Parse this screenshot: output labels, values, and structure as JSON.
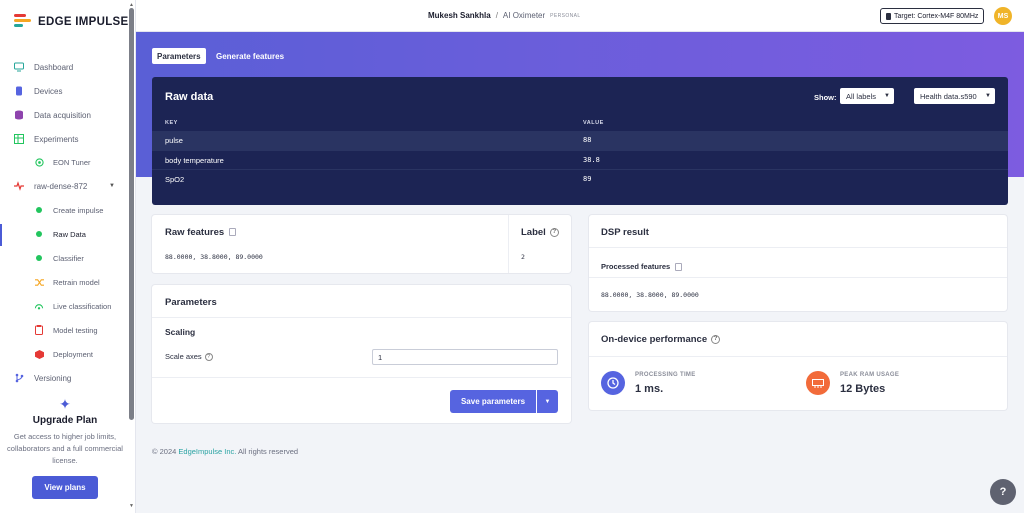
{
  "app": {
    "brand": "EDGE IMPULSE",
    "brand_colors": [
      "#e53935",
      "#f5a623",
      "#26a69a"
    ]
  },
  "sidebar": {
    "items": [
      {
        "label": "Dashboard",
        "icon": "monitor-icon"
      },
      {
        "label": "Devices",
        "icon": "devices-icon"
      },
      {
        "label": "Data acquisition",
        "icon": "database-icon"
      },
      {
        "label": "Experiments",
        "icon": "table-icon"
      },
      {
        "label": "EON Tuner",
        "icon": "tuner-icon"
      },
      {
        "label": "raw-dense-872",
        "icon": "pulse-icon"
      },
      {
        "label": "Create impulse",
        "icon": "dot-icon"
      },
      {
        "label": "Raw Data",
        "icon": "dot-icon"
      },
      {
        "label": "Classifier",
        "icon": "dot-icon"
      },
      {
        "label": "Retrain model",
        "icon": "shuffle-icon"
      },
      {
        "label": "Live classification",
        "icon": "live-icon"
      },
      {
        "label": "Model testing",
        "icon": "clipboard-icon"
      },
      {
        "label": "Deployment",
        "icon": "package-icon"
      },
      {
        "label": "Versioning",
        "icon": "branch-icon"
      }
    ],
    "upgrade": {
      "title": "Upgrade Plan",
      "text": "Get access to higher job limits, collaborators and a full commercial license.",
      "button": "View plans"
    }
  },
  "header": {
    "user": "Mukesh Sankhla",
    "separator": "/",
    "project": "AI Oximeter",
    "badge": "PERSONAL",
    "target": "Target: Cortex-M4F 80MHz",
    "avatar": "MS"
  },
  "tabs": {
    "parameters": "Parameters",
    "generate": "Generate features"
  },
  "raw_data": {
    "title": "Raw data",
    "show_label": "Show:",
    "filter_value": "All labels",
    "sample_value": "Health data.s590",
    "col_key": "KEY",
    "col_value": "VALUE",
    "rows": [
      {
        "key": "pulse",
        "value": "88"
      },
      {
        "key": "body temperature",
        "value": "38.8"
      },
      {
        "key": "SpO2",
        "value": "89"
      }
    ]
  },
  "raw_features": {
    "title": "Raw features",
    "value": "88.0000, 38.8000, 89.0000",
    "label_title": "Label",
    "label_value": "2"
  },
  "parameters": {
    "title": "Parameters",
    "section": "Scaling",
    "scale_label": "Scale axes",
    "scale_value": "1",
    "save_button": "Save parameters"
  },
  "dsp": {
    "title": "DSP result",
    "processed_label": "Processed features",
    "processed_value": "88.0000, 38.8000, 89.0000"
  },
  "performance": {
    "title": "On-device performance",
    "processing_label": "PROCESSING TIME",
    "processing_value": "1 ms.",
    "ram_label": "PEAK RAM USAGE",
    "ram_value": "12 Bytes"
  },
  "footer": {
    "copyright": "© 2024",
    "company": "EdgeImpulse Inc.",
    "rights": "All rights reserved"
  }
}
